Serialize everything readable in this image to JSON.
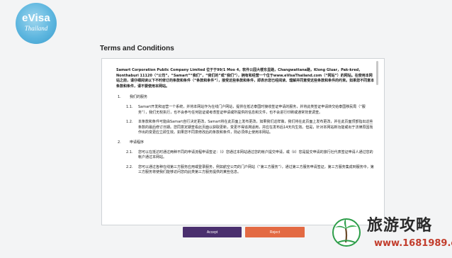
{
  "logo": {
    "main": "eVisa",
    "sub": "Thailand"
  },
  "page": {
    "title": "Terms and Conditions"
  },
  "document": {
    "intro": "Samart Corporation Public Company Limited 位于于99/1 Moo 4，软件公园大楼东显路，Changwattana路，Klong Gluar，Pak-kred，Nonthaburi 11120（“公司”，“Samart”“我们”，“我们的”或“我们”），拥有和经营一个位于www.eVisaThailand.com（“网站”）的网站。在使用本网站之前，请仔细阅读以下不时修订的条款和条件（“条款和条件”），接受这些条款和条件，即表示您已经阅读、理解并同意受这些条款和条件的约束。如果您不同意本条款和条件，请不要使用本网站。",
    "section1": {
      "num": "1.",
      "title": "我们的服务"
    },
    "item1_1": {
      "num": "1.1.",
      "text": "Samart开发和运营一个系统，并将本网站作为在线门户网站，提供在抵达泰国时接收签证申请的服务，并将此类签证申请转交给泰国移民局（“服务”），我们无权执行，也不会参与任何验证或考虑签证申请或所提供的信息和文件，也不会进行印刷或通常背景调查。"
    },
    "item1_2": {
      "num": "1.2.",
      "text": "本条款和条件可能由Samart自行决定更改，Samart将在此页面上发布更改，如果我们这样做，我们将在此页面上发布更改，并在此页面顶部指出这些条款的最后修订日期。您同意定期查看此页面以获取更新，变更不得追溯适用，并应在发布后14天内生效。但是，针对本网站新功能或出于法律原因而作出的变更应立即生效。如果您不同意修改后的条款和条件，则必须停止使用本网站。"
    },
    "section2": {
      "num": "2.",
      "title": "申请程序"
    },
    "item2_1": {
      "num": "2.1.",
      "text": "您可以在抵达时通过两种不同的申请流程申请签证：（i）您通过本网站通过您的帐户提交申请，或（ii）您是提交申请的旅行社代表签证申请人通过您的帐户通过本网站。"
    },
    "item2_2": {
      "num": "2.2.",
      "text": "您可以通过各种在线第三方服务应用或登录服务，例如航空公司的门户网站（“第三方服务”），通过第三方服务申请签证，第三方服务集成到服务中，第三方服务将使我们能够访问您向此类第三方服务提供的某些信息。"
    }
  },
  "buttons": {
    "accept": "Accept",
    "reject": "Reject"
  },
  "watermark": {
    "title": "旅游攻略",
    "url": "www.1681989.cn"
  }
}
